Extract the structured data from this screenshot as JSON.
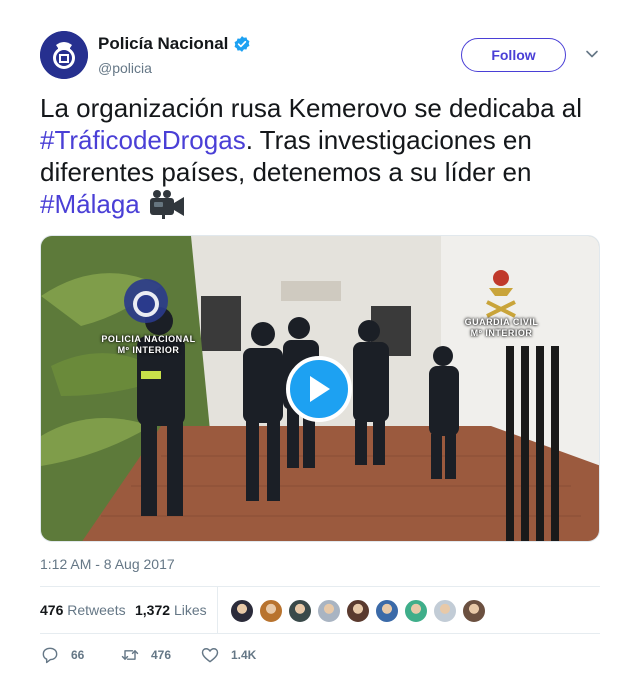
{
  "account": {
    "name": "Policía Nacional",
    "handle": "@policia",
    "verified": true,
    "follow_label": "Follow"
  },
  "tweet": {
    "text_parts": [
      {
        "text": "La organización rusa Kemerovo se dedicaba al ",
        "type": "text"
      },
      {
        "text": "#TráficodeDrogas",
        "type": "hashtag"
      },
      {
        "text": ". Tras investigaciones en diferentes países, detenemos a su líder en ",
        "type": "text"
      },
      {
        "text": "#Málaga",
        "type": "hashtag"
      }
    ],
    "emoji_icon": "video-camera-icon",
    "timestamp": "1:12 AM - 8 Aug 2017"
  },
  "video": {
    "watermark_left": "POLICIA NACIONAL\nMº INTERIOR",
    "watermark_right": "GUARDIA CIVIL\nMº INTERIOR",
    "play_icon": "play-icon"
  },
  "stats": {
    "retweets_count": "476",
    "retweets_label": "Retweets",
    "likes_count": "1,372",
    "likes_label": "Likes",
    "liker_avatars": [
      "#2b2b3a",
      "#b8732e",
      "#3a4a4a",
      "#a9b4c2",
      "#5a3a2e",
      "#3b6aa8",
      "#3fae8a",
      "#c2ccd6",
      "#6b5040"
    ]
  },
  "actions": {
    "reply_count": "66",
    "retweet_count": "476",
    "like_count": "1.4K"
  },
  "colors": {
    "accent": "#4a3fd6",
    "play": "#1da1f2",
    "muted": "#657786"
  }
}
